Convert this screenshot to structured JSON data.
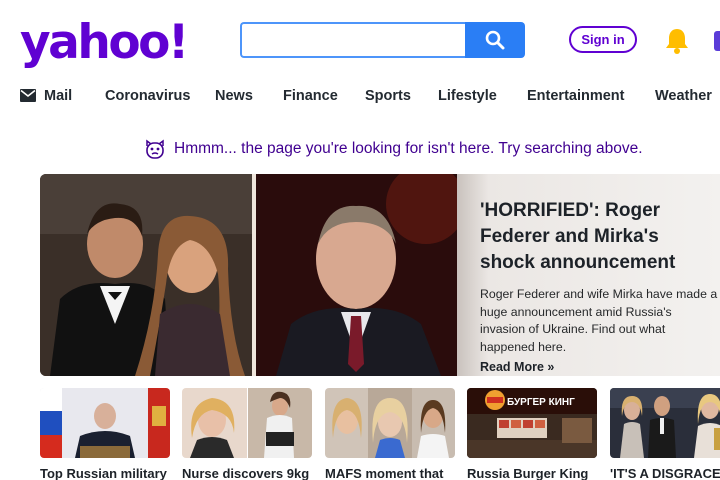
{
  "header": {
    "logo": "yahoo!",
    "search": {
      "value": "",
      "placeholder": ""
    },
    "signin_label": "Sign in"
  },
  "nav": {
    "items": [
      {
        "label": "Mail",
        "icon": "mail-icon"
      },
      {
        "label": "Coronavirus"
      },
      {
        "label": "News"
      },
      {
        "label": "Finance"
      },
      {
        "label": "Sports"
      },
      {
        "label": "Lifestyle"
      },
      {
        "label": "Entertainment"
      },
      {
        "label": "Weather"
      }
    ]
  },
  "notice": {
    "text": "Hmmm... the page you're looking for isn't here. Try searching above.",
    "icon": "confused-face-icon"
  },
  "hero": {
    "title": "'HORRIFIED': Roger Federer and Mirka's shock announcement",
    "description": "Roger Federer and wife Mirka have made a huge announcement amid Russia's invasion of Ukraine. Find out what happened here.",
    "more_label": "Read More »"
  },
  "cards": [
    {
      "title": "Top Russian military"
    },
    {
      "title": "Nurse discovers 9kg"
    },
    {
      "title": "MAFS moment that"
    },
    {
      "title": "Russia Burger King"
    },
    {
      "title": "'IT'S A DISGRACE':"
    }
  ],
  "card_sign": {
    "text": "БУРГЕР КИНГ"
  },
  "colors": {
    "brand": "#6001d2",
    "search_button": "#2a7ef5",
    "notice_text": "#400090",
    "bell": "#ffbd00"
  }
}
